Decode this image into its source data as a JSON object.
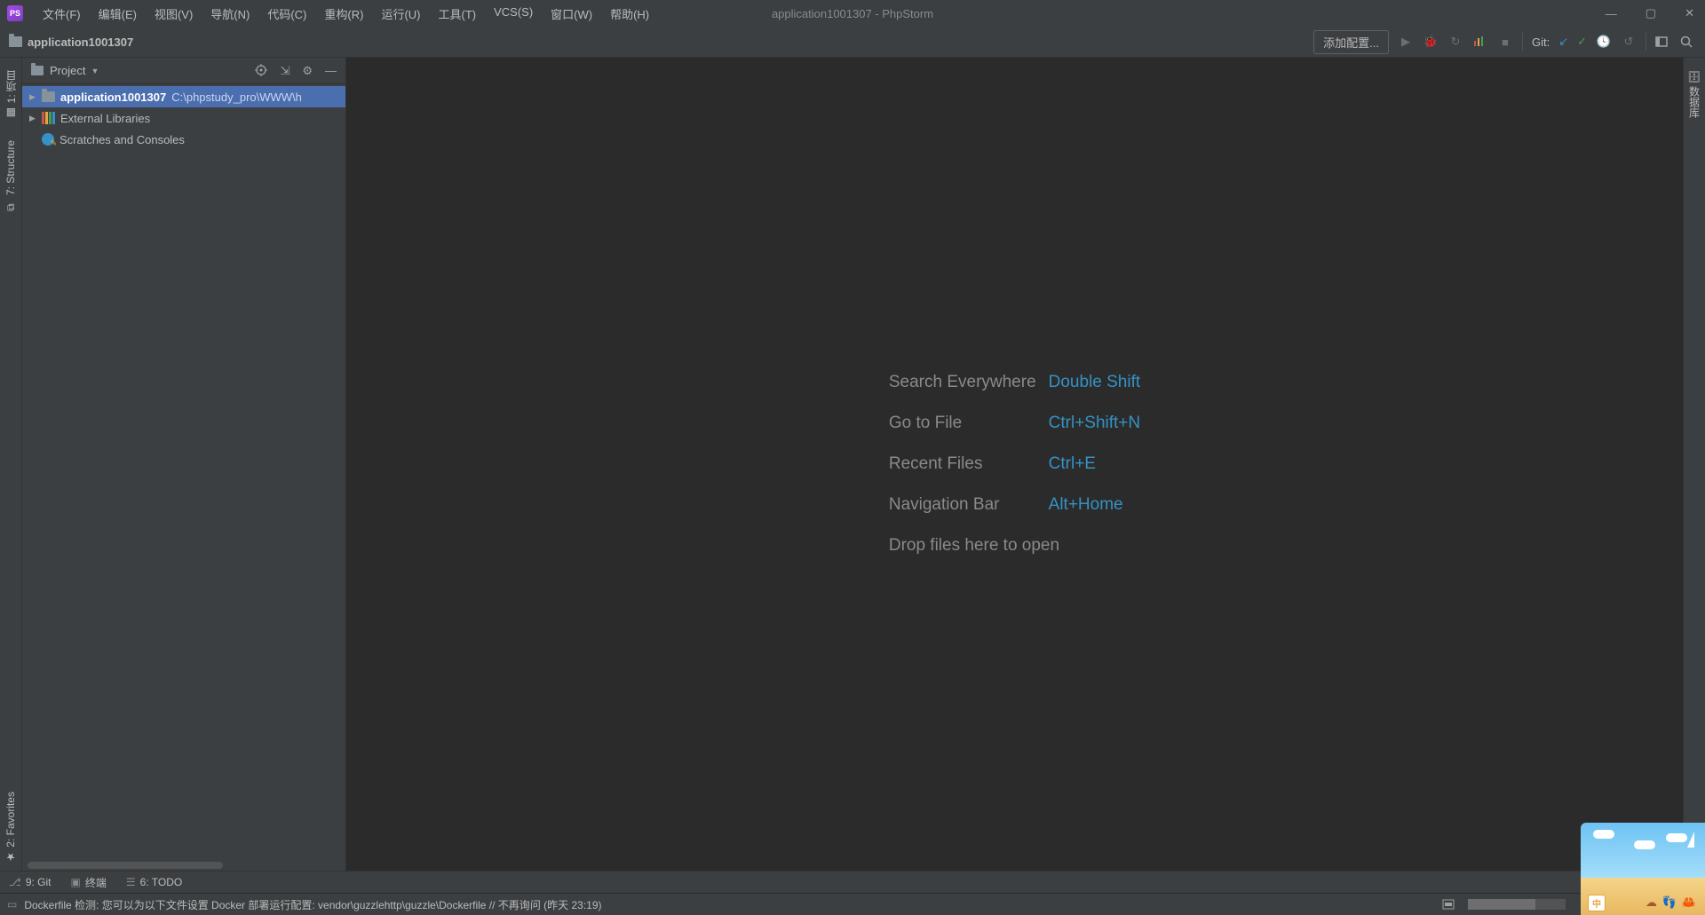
{
  "titlebar": {
    "app_name": "PS",
    "menu": [
      "文件(F)",
      "编辑(E)",
      "视图(V)",
      "导航(N)",
      "代码(C)",
      "重构(R)",
      "运行(U)",
      "工具(T)",
      "VCS(S)",
      "窗口(W)",
      "帮助(H)"
    ],
    "title": "application1001307 - PhpStorm"
  },
  "navbar": {
    "breadcrumb": "application1001307",
    "add_config": "添加配置...",
    "git_label": "Git:"
  },
  "project": {
    "header": "Project",
    "root_name": "application1001307",
    "root_path": "C:\\phpstudy_pro\\WWW\\h",
    "external": "External Libraries",
    "scratches": "Scratches and Consoles"
  },
  "leftGutter": {
    "project": "1: 项目",
    "structure": "7: Structure",
    "favorites": "2: Favorites"
  },
  "rightGutter": {
    "db": "数据库"
  },
  "editor": {
    "rows": [
      {
        "label": "Search Everywhere",
        "key": "Double Shift"
      },
      {
        "label": "Go to File",
        "key": "Ctrl+Shift+N"
      },
      {
        "label": "Recent Files",
        "key": "Ctrl+E"
      },
      {
        "label": "Navigation Bar",
        "key": "Alt+Home"
      }
    ],
    "drop": "Drop files here to open"
  },
  "bottomTabs": {
    "git": "9: Git",
    "terminal": "终端",
    "todo": "6: TODO"
  },
  "statusbar": {
    "msg": "Dockerfile 检测: 您可以为以下文件设置 Docker 部署运行配置: vendor\\guzzlehttp\\guzzle\\Dockerfile // 不再询问 (昨天 23:19)"
  },
  "thumb": {
    "badge": "中"
  }
}
